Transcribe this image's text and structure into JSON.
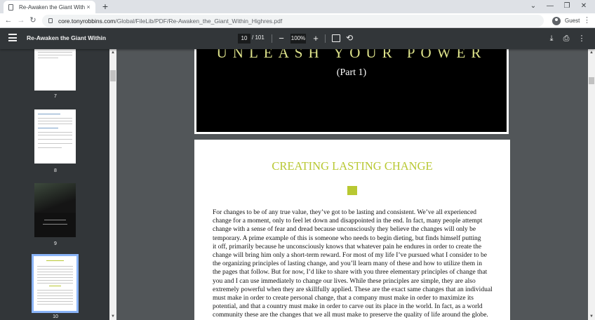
{
  "browser": {
    "tab_title": "Re-Awaken the Giant Within",
    "tab_close": "×",
    "new_tab": "+",
    "url_host": "core.tonyrobbins.com",
    "url_path": "/Global/FileLib/PDF/Re-Awaken_the_Giant_Within_Highres.pdf",
    "profile_label": "Guest",
    "window_controls": [
      "⌄",
      "—",
      "❐",
      "✕"
    ]
  },
  "pdf_toolbar": {
    "title": "Re-Awaken the Giant Within",
    "current_page": "10",
    "page_total": "/ 101",
    "zoom": "100%"
  },
  "thumbnails": [
    {
      "number": "7"
    },
    {
      "number": "8"
    },
    {
      "number": "9"
    },
    {
      "number": "10",
      "selected": true
    }
  ],
  "page_part": {
    "heading": "UNLEASH YOUR POWER",
    "subheading": "(Part 1)"
  },
  "page_chapter": {
    "heading": "CREATING LASTING CHANGE",
    "accent_color": "#b8c832",
    "lines": [
      "For changes to be of any true value, they’ve got to be lasting and consistent. We’ve all experienced",
      "change for a moment, only to feel let down and disappointed in the end. In fact, many people attempt",
      "change with a sense of fear and dread because unconsciously they believe the changes will only be",
      "temporary. A prime example of this is someone who needs to begin dieting, but finds himself putting",
      "it off, primarily because he unconsciously knows that whatever pain he endures in order to create the",
      "change will bring him only a short-term reward. For most of my life I’ve pursued what I consider to be",
      "the organizing principles of lasting change, and you’ll learn many of these and how to utilize them in",
      "the pages that follow. But for now, I’d like to share with you three elementary principles of change that",
      "you and I can use immediately to change our lives. While these principles are simple, they are also",
      "extremely powerful when they are skillfully applied. These are the exact same changes that an individual",
      "must make in order to create personal change, that a company must make in order to maximize its",
      "potential, and that a country must make in order to carve out its place in the world. In fact, as a world",
      "community these are the changes that we all must make to preserve the quality of life around the globe."
    ]
  }
}
